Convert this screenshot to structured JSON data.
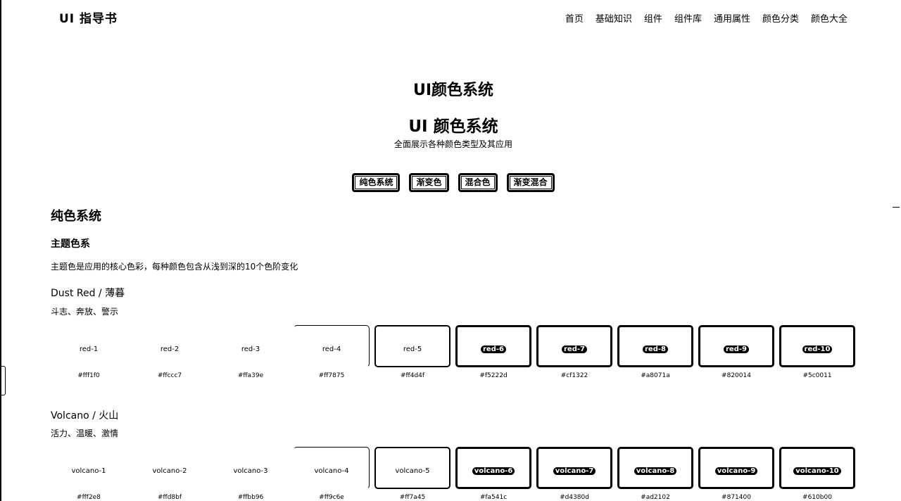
{
  "header": {
    "logo": "UI 指导书",
    "nav": [
      "首页",
      "基础知识",
      "组件",
      "组件库",
      "通用属性",
      "颜色分类",
      "颜色大全"
    ]
  },
  "hero": {
    "title": "UI颜色系统",
    "heading": "UI 颜色系统",
    "subtitle": "全面展示各种颜色类型及其应用"
  },
  "tabs": [
    "纯色系统",
    "渐变色",
    "混合色",
    "渐变混合"
  ],
  "section": {
    "title": "纯色系统",
    "subtitle": "主题色系",
    "description": "主题色是应用的核心色彩，每种颜色包含从浅到深的10个色阶变化"
  },
  "families": [
    {
      "name": "Dust Red / 薄暮",
      "desc": "斗志、奔放、警示",
      "swatches": [
        {
          "label": "red-1",
          "hex": "#fff1f0"
        },
        {
          "label": "red-2",
          "hex": "#ffccc7"
        },
        {
          "label": "red-3",
          "hex": "#ffa39e"
        },
        {
          "label": "red-4",
          "hex": "#ff7875"
        },
        {
          "label": "red-5",
          "hex": "#ff4d4f"
        },
        {
          "label": "red-6",
          "hex": "#f5222d"
        },
        {
          "label": "red-7",
          "hex": "#cf1322"
        },
        {
          "label": "red-8",
          "hex": "#a8071a"
        },
        {
          "label": "red-9",
          "hex": "#820014"
        },
        {
          "label": "red-10",
          "hex": "#5c0011"
        }
      ]
    },
    {
      "name": "Volcano / 火山",
      "desc": "活力、温暖、激情",
      "swatches": [
        {
          "label": "volcano-1",
          "hex": "#fff2e8"
        },
        {
          "label": "volcano-2",
          "hex": "#ffd8bf"
        },
        {
          "label": "volcano-3",
          "hex": "#ffbb96"
        },
        {
          "label": "volcano-4",
          "hex": "#ff9c6e"
        },
        {
          "label": "volcano-5",
          "hex": "#ff7a45"
        },
        {
          "label": "volcano-6",
          "hex": "#fa541c"
        },
        {
          "label": "volcano-7",
          "hex": "#d4380d"
        },
        {
          "label": "volcano-8",
          "hex": "#ad2102"
        },
        {
          "label": "volcano-9",
          "hex": "#871400"
        },
        {
          "label": "volcano-10",
          "hex": "#610b00"
        }
      ]
    }
  ]
}
